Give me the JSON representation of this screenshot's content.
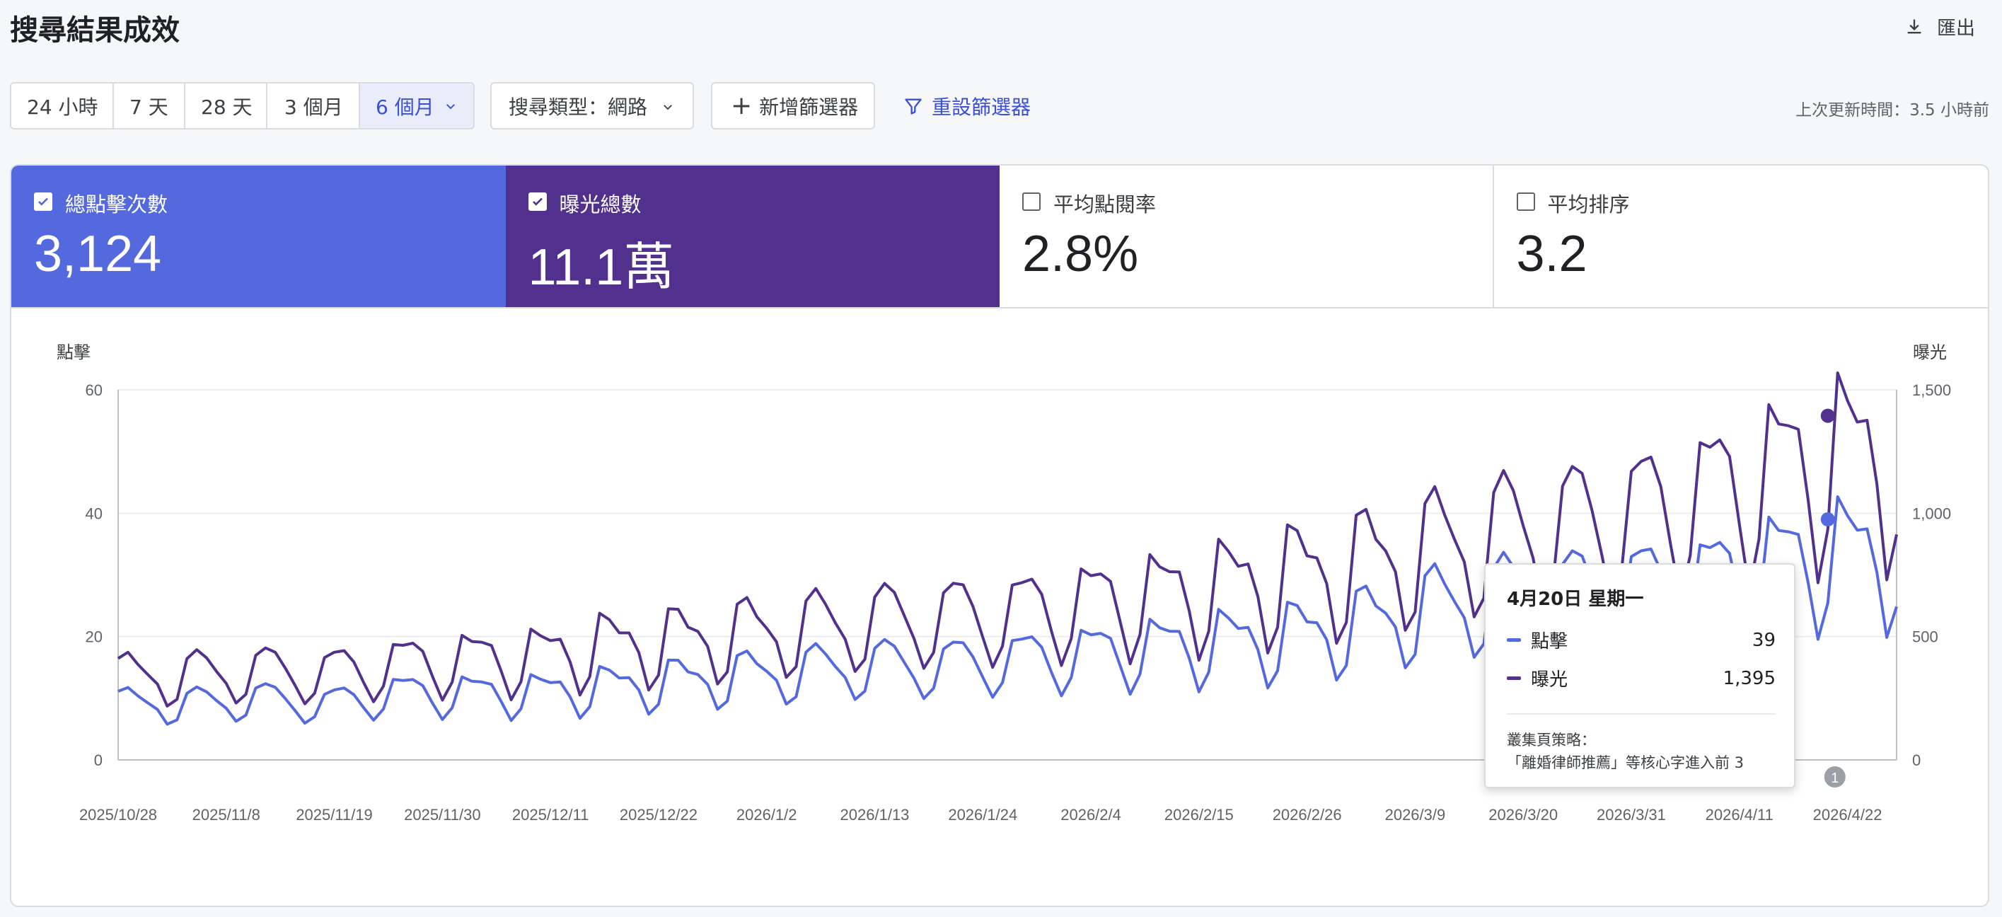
{
  "page": {
    "title": "搜尋結果成效",
    "export_label": "匯出"
  },
  "toolbar": {
    "ranges": [
      "24 小時",
      "7 天",
      "28 天",
      "3 個月",
      "6 個月"
    ],
    "active_range": "6 個月",
    "search_type": "搜尋類型：網路",
    "add_filter": "新增篩選器",
    "reset_filter": "重設篩選器",
    "last_updated": "上次更新時間：3.5 小時前"
  },
  "metrics": [
    {
      "label": "總點擊次數",
      "value": "3,124",
      "checked": true
    },
    {
      "label": "曝光總數",
      "value": "11.1萬",
      "checked": true
    },
    {
      "label": "平均點閱率",
      "value": "2.8%",
      "checked": false
    },
    {
      "label": "平均排序",
      "value": "3.2",
      "checked": false
    }
  ],
  "tooltip": {
    "date": "4月20日 星期一",
    "rows": [
      {
        "name": "點擊",
        "value": "39"
      },
      {
        "name": "曝光",
        "value": "1,395"
      }
    ],
    "note_title": "叢集頁策略：",
    "note": "「離婚律師推薦」等核心字進入前 3"
  },
  "annotation_marker": "1",
  "colors": {
    "clicks": "#5469de",
    "impressions": "#52308e",
    "accent": "#3b4fd6"
  },
  "chart_data": {
    "type": "line",
    "ylabel_left": "點擊",
    "ylabel_right": "曝光",
    "ylim_left": [
      0,
      60
    ],
    "ylim_right": [
      0,
      1500
    ],
    "yticks_left": [
      0,
      20,
      40,
      60
    ],
    "yticks_right": [
      "0",
      "500",
      "1,000",
      "1,500"
    ],
    "x_start": "2025/10/28",
    "x_end": "2026/4/27",
    "xtick_labels": [
      "2025/10/28",
      "2025/11/8",
      "2025/11/19",
      "2025/11/30",
      "2025/12/11",
      "2025/12/22",
      "2026/1/2",
      "2026/1/13",
      "2026/1/24",
      "2026/2/4",
      "2026/2/15",
      "2026/2/26",
      "2026/3/9",
      "2026/3/20",
      "2026/3/31",
      "2026/4/11",
      "2026/4/22"
    ],
    "grid": true,
    "legend": "none",
    "highlight_date": "2026/4/20",
    "series": [
      {
        "name": "點擊",
        "axis": "left",
        "weekly": [
          10,
          10,
          11,
          10,
          12,
          12,
          12,
          13,
          14,
          15,
          16,
          17,
          17,
          18,
          19,
          20,
          21,
          22,
          24,
          27,
          29,
          30,
          31,
          32,
          35,
          37
        ]
      },
      {
        "name": "曝光",
        "axis": "right",
        "weekly": [
          370,
          380,
          400,
          390,
          430,
          450,
          460,
          510,
          530,
          560,
          590,
          620,
          640,
          660,
          700,
          730,
          770,
          820,
          870,
          940,
          1010,
          1050,
          1100,
          1180,
          1280,
          1360
        ]
      }
    ]
  }
}
